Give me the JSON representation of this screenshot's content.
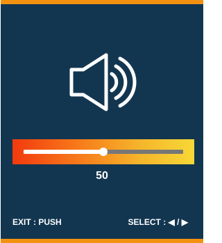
{
  "volume": {
    "icon": "speaker-volume-icon",
    "value": "50",
    "level_fraction": 0.5
  },
  "footer": {
    "exit_label": "EXIT : PUSH",
    "select_label": "SELECT : ◀ / ▶"
  },
  "colors": {
    "background": "#133650",
    "accent": "#f39210",
    "gradient_start": "#f23a0e",
    "gradient_end": "#f7d836",
    "track": "#777777"
  }
}
